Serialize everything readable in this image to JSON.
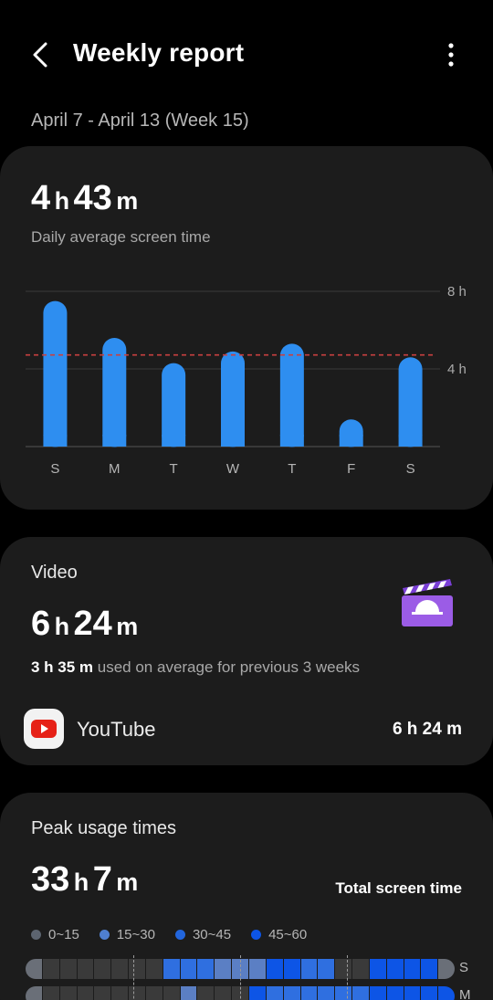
{
  "header": {
    "title": "Weekly report",
    "back_icon": "chevron-left-icon",
    "more_icon": "more-vertical-icon"
  },
  "week_range": "April 7 - April 13 (Week 15)",
  "summary": {
    "hours": "4",
    "minutes": "43",
    "h": "h",
    "m": "m",
    "label": "Daily average screen time"
  },
  "chart_data": {
    "type": "bar",
    "categories": [
      "S",
      "M",
      "T",
      "W",
      "T",
      "F",
      "S"
    ],
    "values": [
      7.5,
      5.6,
      4.3,
      4.9,
      5.3,
      1.4,
      4.6
    ],
    "unit": "hours",
    "ylim": [
      0,
      8
    ],
    "y_ticks": [
      "8 h",
      "4 h"
    ],
    "y_tick_values": [
      8,
      4
    ],
    "average_line": 4.72,
    "bar_color": "#2e8ef0",
    "average_line_color": "#c84040",
    "grid": true
  },
  "video": {
    "category": "Video",
    "hours": "6",
    "minutes": "24",
    "h": "h",
    "m": "m",
    "prev_avg_value": "3 h 35 m",
    "prev_avg_text": " used on average for previous 3 weeks",
    "icon": "clapperboard-icon",
    "app": {
      "name": "YouTube",
      "time": "6 h 24 m",
      "icon": "youtube-icon"
    }
  },
  "peak": {
    "title": "Peak usage times",
    "hours": "33",
    "minutes": "7",
    "h": "h",
    "m": "m",
    "total_label": "Total screen time",
    "legend": [
      {
        "label": "0~15",
        "color": "#5c6470"
      },
      {
        "label": "15~30",
        "color": "#4f7fd0"
      },
      {
        "label": "30~45",
        "color": "#2266dd"
      },
      {
        "label": "45~60",
        "color": "#0d55e6"
      }
    ],
    "rows": [
      {
        "day": "S",
        "levels": [
          0,
          0,
          0,
          0,
          0,
          0,
          0,
          0,
          2,
          2,
          2,
          1,
          1,
          1,
          3,
          3,
          2,
          2,
          0,
          0,
          3,
          3,
          3,
          3,
          0
        ]
      },
      {
        "day": "M",
        "levels": [
          0,
          0,
          0,
          0,
          0,
          0,
          0,
          0,
          0,
          1,
          0,
          0,
          0,
          3,
          2,
          2,
          2,
          2,
          2,
          2,
          3,
          3,
          3,
          3,
          3
        ]
      }
    ]
  }
}
